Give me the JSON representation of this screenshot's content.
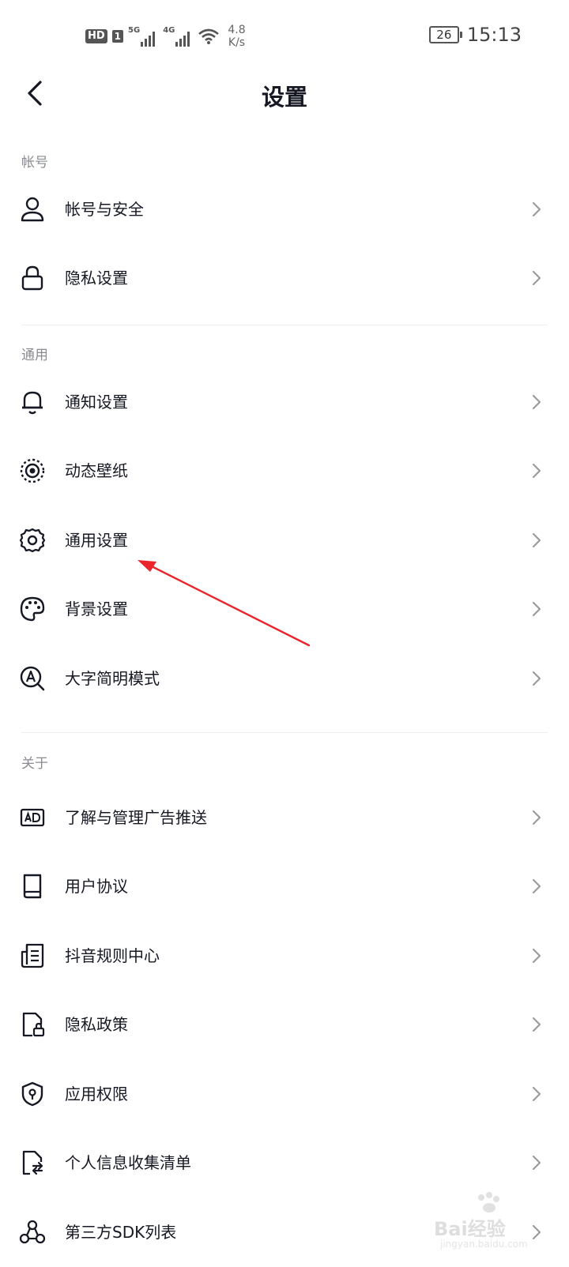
{
  "status_bar": {
    "hd": "HD",
    "sim": "1",
    "net1": "5G",
    "net2": "4G",
    "speed_value": "4.8",
    "speed_unit": "K/s",
    "battery": "26",
    "time": "15:13"
  },
  "header": {
    "title": "设置"
  },
  "sections": [
    {
      "title": "帐号",
      "items": [
        {
          "label": "帐号与安全",
          "icon": "user-icon"
        },
        {
          "label": "隐私设置",
          "icon": "lock-icon"
        }
      ]
    },
    {
      "title": "通用",
      "items": [
        {
          "label": "通知设置",
          "icon": "bell-icon"
        },
        {
          "label": "动态壁纸",
          "icon": "live-wallpaper-icon"
        },
        {
          "label": "通用设置",
          "icon": "gear-icon"
        },
        {
          "label": "背景设置",
          "icon": "palette-icon"
        },
        {
          "label": "大字简明模式",
          "icon": "large-text-icon"
        }
      ]
    },
    {
      "title": "关于",
      "items": [
        {
          "label": "了解与管理广告推送",
          "icon": "ad-icon"
        },
        {
          "label": "用户协议",
          "icon": "book-icon"
        },
        {
          "label": "抖音规则中心",
          "icon": "rules-document-icon"
        },
        {
          "label": "隐私政策",
          "icon": "privacy-document-icon"
        },
        {
          "label": "应用权限",
          "icon": "shield-icon"
        },
        {
          "label": "个人信息收集清单",
          "icon": "personal-info-icon"
        },
        {
          "label": "第三方SDK列表",
          "icon": "sdk-network-icon"
        }
      ]
    }
  ],
  "annotation": {
    "color": "#e8262c"
  },
  "watermark": {
    "text": "Bai经验",
    "url": "jingyan.baidu.com"
  }
}
